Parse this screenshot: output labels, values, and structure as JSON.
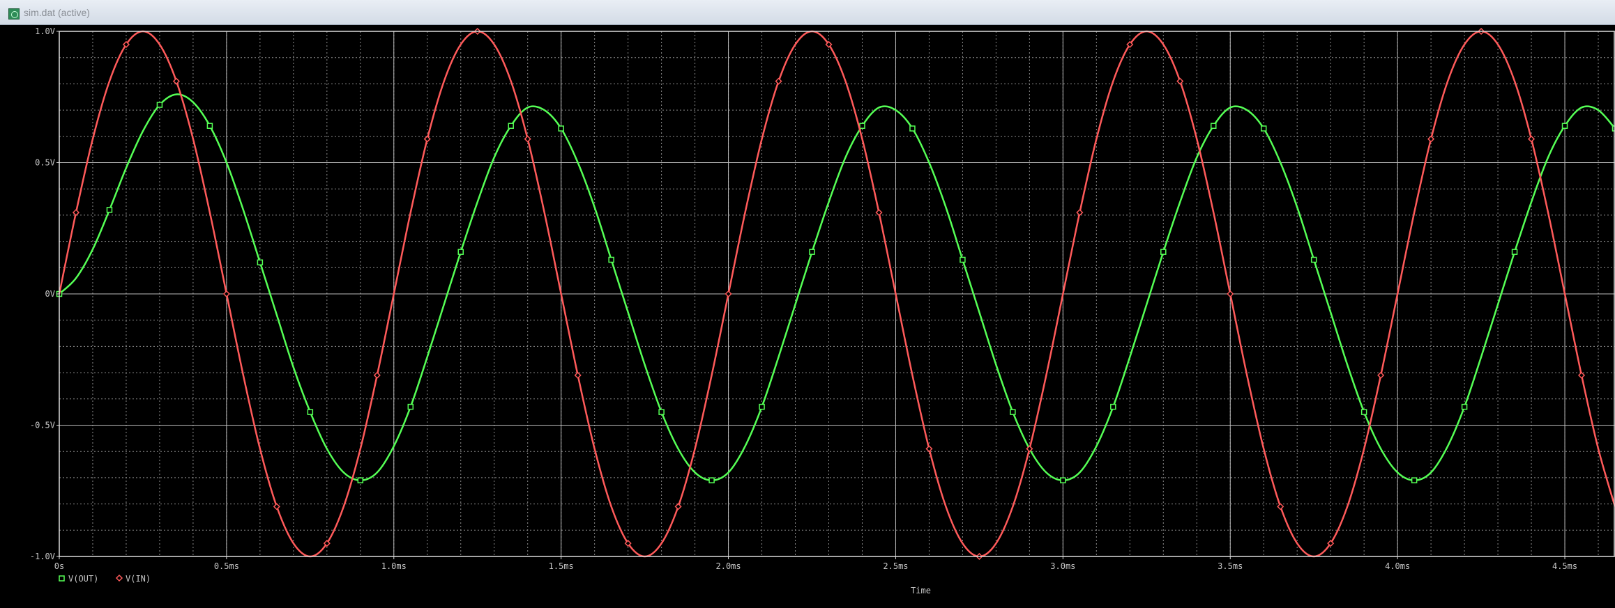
{
  "window": {
    "title": "sim.dat (active)"
  },
  "colors": {
    "background": "#000000",
    "grid_major": "#bdbdbd",
    "grid_minor": "#8c8c8c",
    "v_out": "#55ff55",
    "v_in": "#ff5a5a"
  },
  "chart_data": {
    "type": "line",
    "xlabel": "Time",
    "ylabel": "",
    "xlim": [
      0,
      4.65
    ],
    "ylim": [
      -1.0,
      1.0
    ],
    "x_unit": "ms",
    "x_ticks": [
      0,
      0.5,
      1.0,
      1.5,
      2.0,
      2.5,
      3.0,
      3.5,
      4.0,
      4.5
    ],
    "x_tick_labels": [
      "0s",
      "0.5ms",
      "1.0ms",
      "1.5ms",
      "2.0ms",
      "2.5ms",
      "3.0ms",
      "3.5ms",
      "4.0ms",
      "4.5ms"
    ],
    "y_ticks": [
      -1.0,
      -0.5,
      0,
      0.5,
      1.0
    ],
    "y_tick_labels": [
      "-1.0V",
      "-0.5V",
      "0V",
      "0.5V",
      "1.0V"
    ],
    "grid": true,
    "legend_position": "bottom-left",
    "series": [
      {
        "name": "V(OUT)",
        "marker": "square",
        "x": [
          0.0,
          0.05,
          0.1,
          0.15,
          0.2,
          0.25,
          0.3,
          0.35,
          0.4,
          0.45,
          0.5,
          0.55,
          0.6,
          0.65,
          0.7,
          0.75,
          0.8,
          0.85,
          0.9,
          0.95,
          1.0,
          1.05,
          1.1,
          1.15,
          1.2,
          1.25,
          1.3,
          1.35,
          1.4,
          1.45,
          1.5,
          1.55,
          1.6,
          1.65,
          1.7,
          1.75,
          1.8,
          1.85,
          1.9,
          1.95,
          2.0,
          2.05,
          2.1,
          2.15,
          2.2,
          2.25,
          2.3,
          2.35,
          2.4,
          2.45,
          2.5,
          2.55,
          2.6,
          2.65,
          2.7,
          2.75,
          2.8,
          2.85,
          2.9,
          2.95,
          3.0,
          3.05,
          3.1,
          3.15,
          3.2,
          3.25,
          3.3,
          3.35,
          3.4,
          3.45,
          3.5,
          3.55,
          3.6,
          3.65,
          3.7,
          3.75,
          3.8,
          3.85,
          3.9,
          3.95,
          4.0,
          4.05,
          4.1,
          4.15,
          4.2,
          4.25,
          4.3,
          4.35,
          4.4,
          4.45,
          4.5,
          4.55,
          4.6,
          4.65
        ],
        "y": [
          0.0,
          0.06,
          0.17,
          0.32,
          0.48,
          0.62,
          0.72,
          0.76,
          0.73,
          0.64,
          0.5,
          0.32,
          0.12,
          -0.08,
          -0.28,
          -0.45,
          -0.59,
          -0.68,
          -0.71,
          -0.68,
          -0.58,
          -0.43,
          -0.24,
          -0.04,
          0.16,
          0.35,
          0.52,
          0.64,
          0.71,
          0.7,
          0.63,
          0.5,
          0.33,
          0.13,
          -0.07,
          -0.27,
          -0.45,
          -0.59,
          -0.68,
          -0.71,
          -0.68,
          -0.58,
          -0.43,
          -0.24,
          -0.04,
          0.16,
          0.35,
          0.52,
          0.64,
          0.71,
          0.7,
          0.63,
          0.5,
          0.33,
          0.13,
          -0.07,
          -0.27,
          -0.45,
          -0.59,
          -0.68,
          -0.71,
          -0.68,
          -0.58,
          -0.43,
          -0.24,
          -0.04,
          0.16,
          0.35,
          0.52,
          0.64,
          0.71,
          0.7,
          0.63,
          0.5,
          0.33,
          0.13,
          -0.07,
          -0.27,
          -0.45,
          -0.59,
          -0.68,
          -0.71,
          -0.68,
          -0.58,
          -0.43,
          -0.24,
          -0.04,
          0.16,
          0.35,
          0.52,
          0.64,
          0.71,
          0.7,
          0.63
        ]
      },
      {
        "name": "V(IN)",
        "marker": "diamond",
        "x": [
          0.0,
          0.05,
          0.1,
          0.15,
          0.2,
          0.25,
          0.3,
          0.35,
          0.4,
          0.45,
          0.5,
          0.55,
          0.6,
          0.65,
          0.7,
          0.75,
          0.8,
          0.85,
          0.9,
          0.95,
          1.0,
          1.05,
          1.1,
          1.15,
          1.2,
          1.25,
          1.3,
          1.35,
          1.4,
          1.45,
          1.5,
          1.55,
          1.6,
          1.65,
          1.7,
          1.75,
          1.8,
          1.85,
          1.9,
          1.95,
          2.0,
          2.05,
          2.1,
          2.15,
          2.2,
          2.25,
          2.3,
          2.35,
          2.4,
          2.45,
          2.5,
          2.55,
          2.6,
          2.65,
          2.7,
          2.75,
          2.8,
          2.85,
          2.9,
          2.95,
          3.0,
          3.05,
          3.1,
          3.15,
          3.2,
          3.25,
          3.3,
          3.35,
          3.4,
          3.45,
          3.5,
          3.55,
          3.6,
          3.65,
          3.7,
          3.75,
          3.8,
          3.85,
          3.9,
          3.95,
          4.0,
          4.05,
          4.1,
          4.15,
          4.2,
          4.25,
          4.3,
          4.35,
          4.4,
          4.45,
          4.5,
          4.55,
          4.6,
          4.65
        ],
        "y": [
          0.0,
          0.31,
          0.59,
          0.81,
          0.95,
          1.0,
          0.95,
          0.81,
          0.59,
          0.31,
          0.0,
          -0.31,
          -0.59,
          -0.81,
          -0.95,
          -1.0,
          -0.95,
          -0.81,
          -0.59,
          -0.31,
          0.0,
          0.31,
          0.59,
          0.81,
          0.95,
          1.0,
          0.95,
          0.81,
          0.59,
          0.31,
          0.0,
          -0.31,
          -0.59,
          -0.81,
          -0.95,
          -1.0,
          -0.95,
          -0.81,
          -0.59,
          -0.31,
          0.0,
          0.31,
          0.59,
          0.81,
          0.95,
          1.0,
          0.95,
          0.81,
          0.59,
          0.31,
          0.0,
          -0.31,
          -0.59,
          -0.81,
          -0.95,
          -1.0,
          -0.95,
          -0.81,
          -0.59,
          -0.31,
          0.0,
          0.31,
          0.59,
          0.81,
          0.95,
          1.0,
          0.95,
          0.81,
          0.59,
          0.31,
          0.0,
          -0.31,
          -0.59,
          -0.81,
          -0.95,
          -1.0,
          -0.95,
          -0.81,
          -0.59,
          -0.31,
          0.0,
          0.31,
          0.59,
          0.81,
          0.95,
          1.0,
          0.95,
          0.81,
          0.59,
          0.31,
          0.0,
          -0.31,
          -0.59,
          -0.81
        ]
      }
    ]
  }
}
